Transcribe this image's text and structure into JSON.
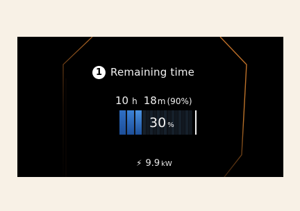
{
  "display": {
    "step_number": "1",
    "title": "Remaining time",
    "time": {
      "hours_value": "10",
      "hours_unit": "h",
      "minutes_value": "18",
      "minutes_unit": "m",
      "target_percent": "(90%)"
    },
    "battery": {
      "value": "30",
      "unit": "%",
      "level_fraction": 0.3
    },
    "power": {
      "icon": "lightning-bolt-icon",
      "value": "9.9",
      "unit": "kW"
    }
  },
  "colors": {
    "background": "#f8f1e6",
    "screen": "#000000",
    "frame_accent": "#c8742a",
    "battery_fill": "#3b82d6"
  }
}
